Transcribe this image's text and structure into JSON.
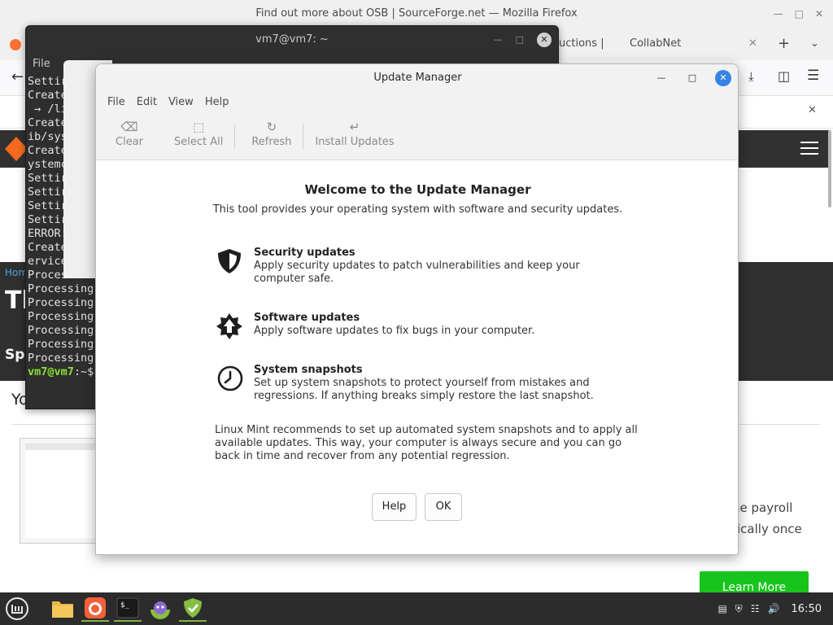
{
  "firefox": {
    "window_title": "Find out more about OSB | SourceForge.net — Mozilla Firefox",
    "tab_partial": "uctions |",
    "tab_collabnet": "CollabNet",
    "hero_home": "Hom",
    "hero_title": "Th",
    "hero_sub": "Sp",
    "you_heading": "Yo",
    "payroll_text": "he payroll",
    "ically_text": "ically once",
    "learn_more": "Learn More"
  },
  "terminal": {
    "title": "vm7@vm7: ~",
    "menu_file": "File",
    "lines": [
      "Settir",
      "Create",
      " → /li",
      "Create",
      "ib/sys",
      "Create",
      "ystemc",
      "Settir",
      "Settir",
      "Settir",
      "Settir",
      "ERROR:",
      "Create",
      "ervice",
      "Proces",
      "Processing",
      "Processing",
      "Processing",
      "Processing",
      "Processing",
      "Processing"
    ],
    "prompt_user": "vm7@vm7",
    "prompt_rest": ":~$"
  },
  "update_manager": {
    "title": "Update Manager",
    "menu": [
      "File",
      "Edit",
      "View",
      "Help"
    ],
    "toolbar": {
      "clear": "Clear",
      "select_all": "Select All",
      "refresh": "Refresh",
      "install_updates": "Install Updates"
    },
    "welcome_title": "Welcome to the Update Manager",
    "welcome_sub": "This tool provides your operating system with software and security updates.",
    "features": [
      {
        "title": "Security updates",
        "desc": "Apply security updates to patch vulnerabilities and keep your computer safe.",
        "icon": "shield-icon"
      },
      {
        "title": "Software updates",
        "desc": "Apply software updates to fix bugs in your computer.",
        "icon": "star-arrow-icon"
      },
      {
        "title": "System snapshots",
        "desc": "Set up system snapshots to protect yourself from mistakes and regressions. If anything breaks simply restore the last snapshot.",
        "icon": "clock-icon"
      }
    ],
    "note": "Linux Mint recommends to set up automated system snapshots and to apply all available updates. This way, your computer is always secure and you can go back in time and recover from any potential regression.",
    "help_button": "Help",
    "ok_button": "OK",
    "close_color": "#3584e4"
  },
  "taskbar": {
    "clock": "16:50",
    "apps": [
      "menu-icon",
      "files-icon",
      "firefox-icon",
      "terminal-icon",
      "mintinstall-icon",
      "update-manager-icon"
    ]
  }
}
